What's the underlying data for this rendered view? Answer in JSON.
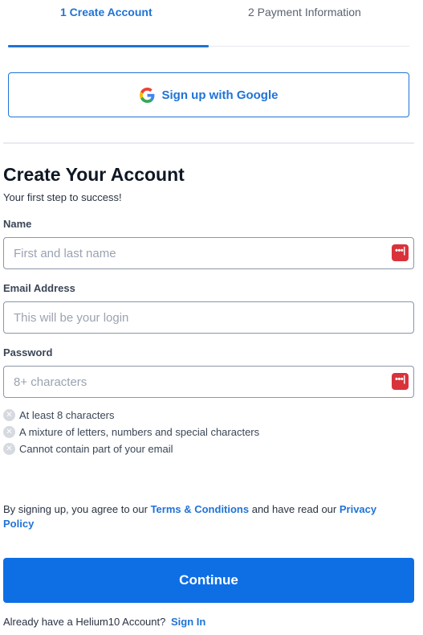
{
  "steps": {
    "step1": "1 Create Account",
    "step2": "2 Payment Information"
  },
  "google": {
    "label": "Sign up with Google",
    "icon": "google-icon"
  },
  "header": {
    "title": "Create Your Account",
    "subtitle": "Your first step to success!"
  },
  "form": {
    "name": {
      "label": "Name",
      "placeholder": "First and last name",
      "value": ""
    },
    "email": {
      "label": "Email Address",
      "placeholder": "This will be your login",
      "value": ""
    },
    "password": {
      "label": "Password",
      "placeholder": "8+ characters",
      "value": ""
    },
    "password_manager_icon": "password-manager-icon"
  },
  "password_rules": [
    "At least 8 characters",
    "A mixture of letters, numbers and special characters",
    "Cannot contain part of your email"
  ],
  "legal": {
    "prefix": "By signing up, you agree to our ",
    "terms": "Terms & Conditions",
    "middle": " and have read our ",
    "privacy": "Privacy Policy"
  },
  "continue_label": "Continue",
  "signin": {
    "prompt": "Already have a Helium10 Account?",
    "link": "Sign In"
  },
  "colors": {
    "accent": "#1f73d6",
    "primary_button": "#0e6fe5",
    "password_manager": "#d9323a"
  }
}
